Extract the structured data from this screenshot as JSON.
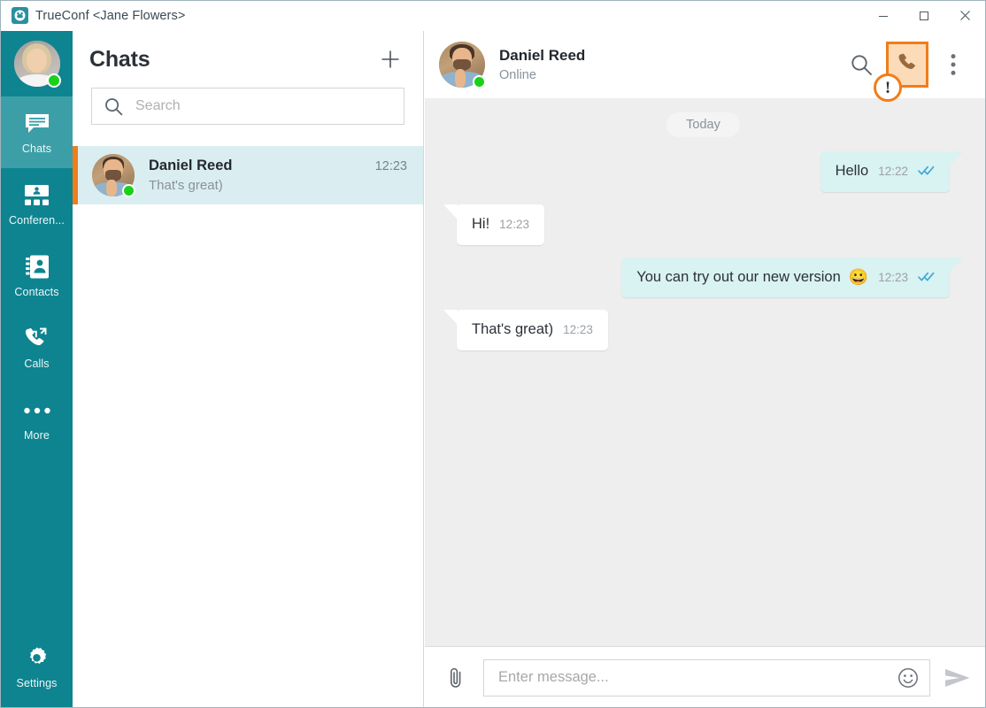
{
  "window": {
    "title": "TrueConf <Jane Flowers>",
    "logo_icon": "trueconf-logo-icon",
    "controls": [
      {
        "name": "minimize",
        "icon": "minimize-icon"
      },
      {
        "name": "maximize",
        "icon": "maximize-icon"
      },
      {
        "name": "close",
        "icon": "close-icon"
      }
    ]
  },
  "sidebar": {
    "user": {
      "avatar_name": "jane-flowers-avatar",
      "presence": "online",
      "presence_color": "#19d119"
    },
    "items": [
      {
        "label": "Chats",
        "icon": "chats-icon",
        "active": true
      },
      {
        "label": "Conferen...",
        "icon": "conferences-icon",
        "active": false
      },
      {
        "label": "Contacts",
        "icon": "contacts-icon",
        "active": false
      },
      {
        "label": "Calls",
        "icon": "calls-icon",
        "active": false
      },
      {
        "label": "More",
        "icon": "more-dots-icon",
        "active": false
      }
    ],
    "settings": {
      "label": "Settings",
      "icon": "gear-icon"
    },
    "bg_color": "#0e8490",
    "active_bg_color": "#3c9fa8"
  },
  "chat_list": {
    "title": "Chats",
    "add_icon": "plus-icon",
    "search": {
      "placeholder": "Search",
      "value": "",
      "icon": "search-icon"
    },
    "rows": [
      {
        "name": "Daniel Reed",
        "time": "12:23",
        "preview": "That's great)",
        "selected": true,
        "presence": "online",
        "avatar_name": "daniel-reed-avatar"
      }
    ],
    "selected_bg": "#daeef2",
    "selected_marker_color": "#f07d1a"
  },
  "conversation": {
    "header": {
      "name": "Daniel Reed",
      "status": "Online",
      "avatar_name": "daniel-reed-avatar",
      "actions": [
        {
          "name": "search-in-chat",
          "icon": "search-icon",
          "highlighted": false
        },
        {
          "name": "call",
          "icon": "phone-icon",
          "highlighted": true
        },
        {
          "name": "more-options",
          "icon": "kebab-menu-icon",
          "highlighted": false
        }
      ],
      "annotation": {
        "badge_text": "!",
        "border_color": "#f07d1a",
        "fill_color": "#fbdbb8"
      }
    },
    "day_separator": "Today",
    "messages": [
      {
        "text": "Hello",
        "time": "12:22",
        "direction": "out",
        "read_receipt": "double-check",
        "emoji": ""
      },
      {
        "text": "Hi!",
        "time": "12:23",
        "direction": "in",
        "read_receipt": "",
        "emoji": ""
      },
      {
        "text": "You can try out our new version",
        "time": "12:23",
        "direction": "out",
        "read_receipt": "double-check",
        "emoji": "😀"
      },
      {
        "text": "That's great)",
        "time": "12:23",
        "direction": "in",
        "read_receipt": "",
        "emoji": ""
      }
    ],
    "composer": {
      "attach_icon": "paperclip-icon",
      "placeholder": "Enter message...",
      "value": "",
      "emoji_icon": "smiley-icon",
      "send_icon": "send-icon"
    },
    "bg_color": "#eeeeee",
    "outgoing_bubble_color": "#d9f2f2",
    "incoming_bubble_color": "#ffffff"
  }
}
